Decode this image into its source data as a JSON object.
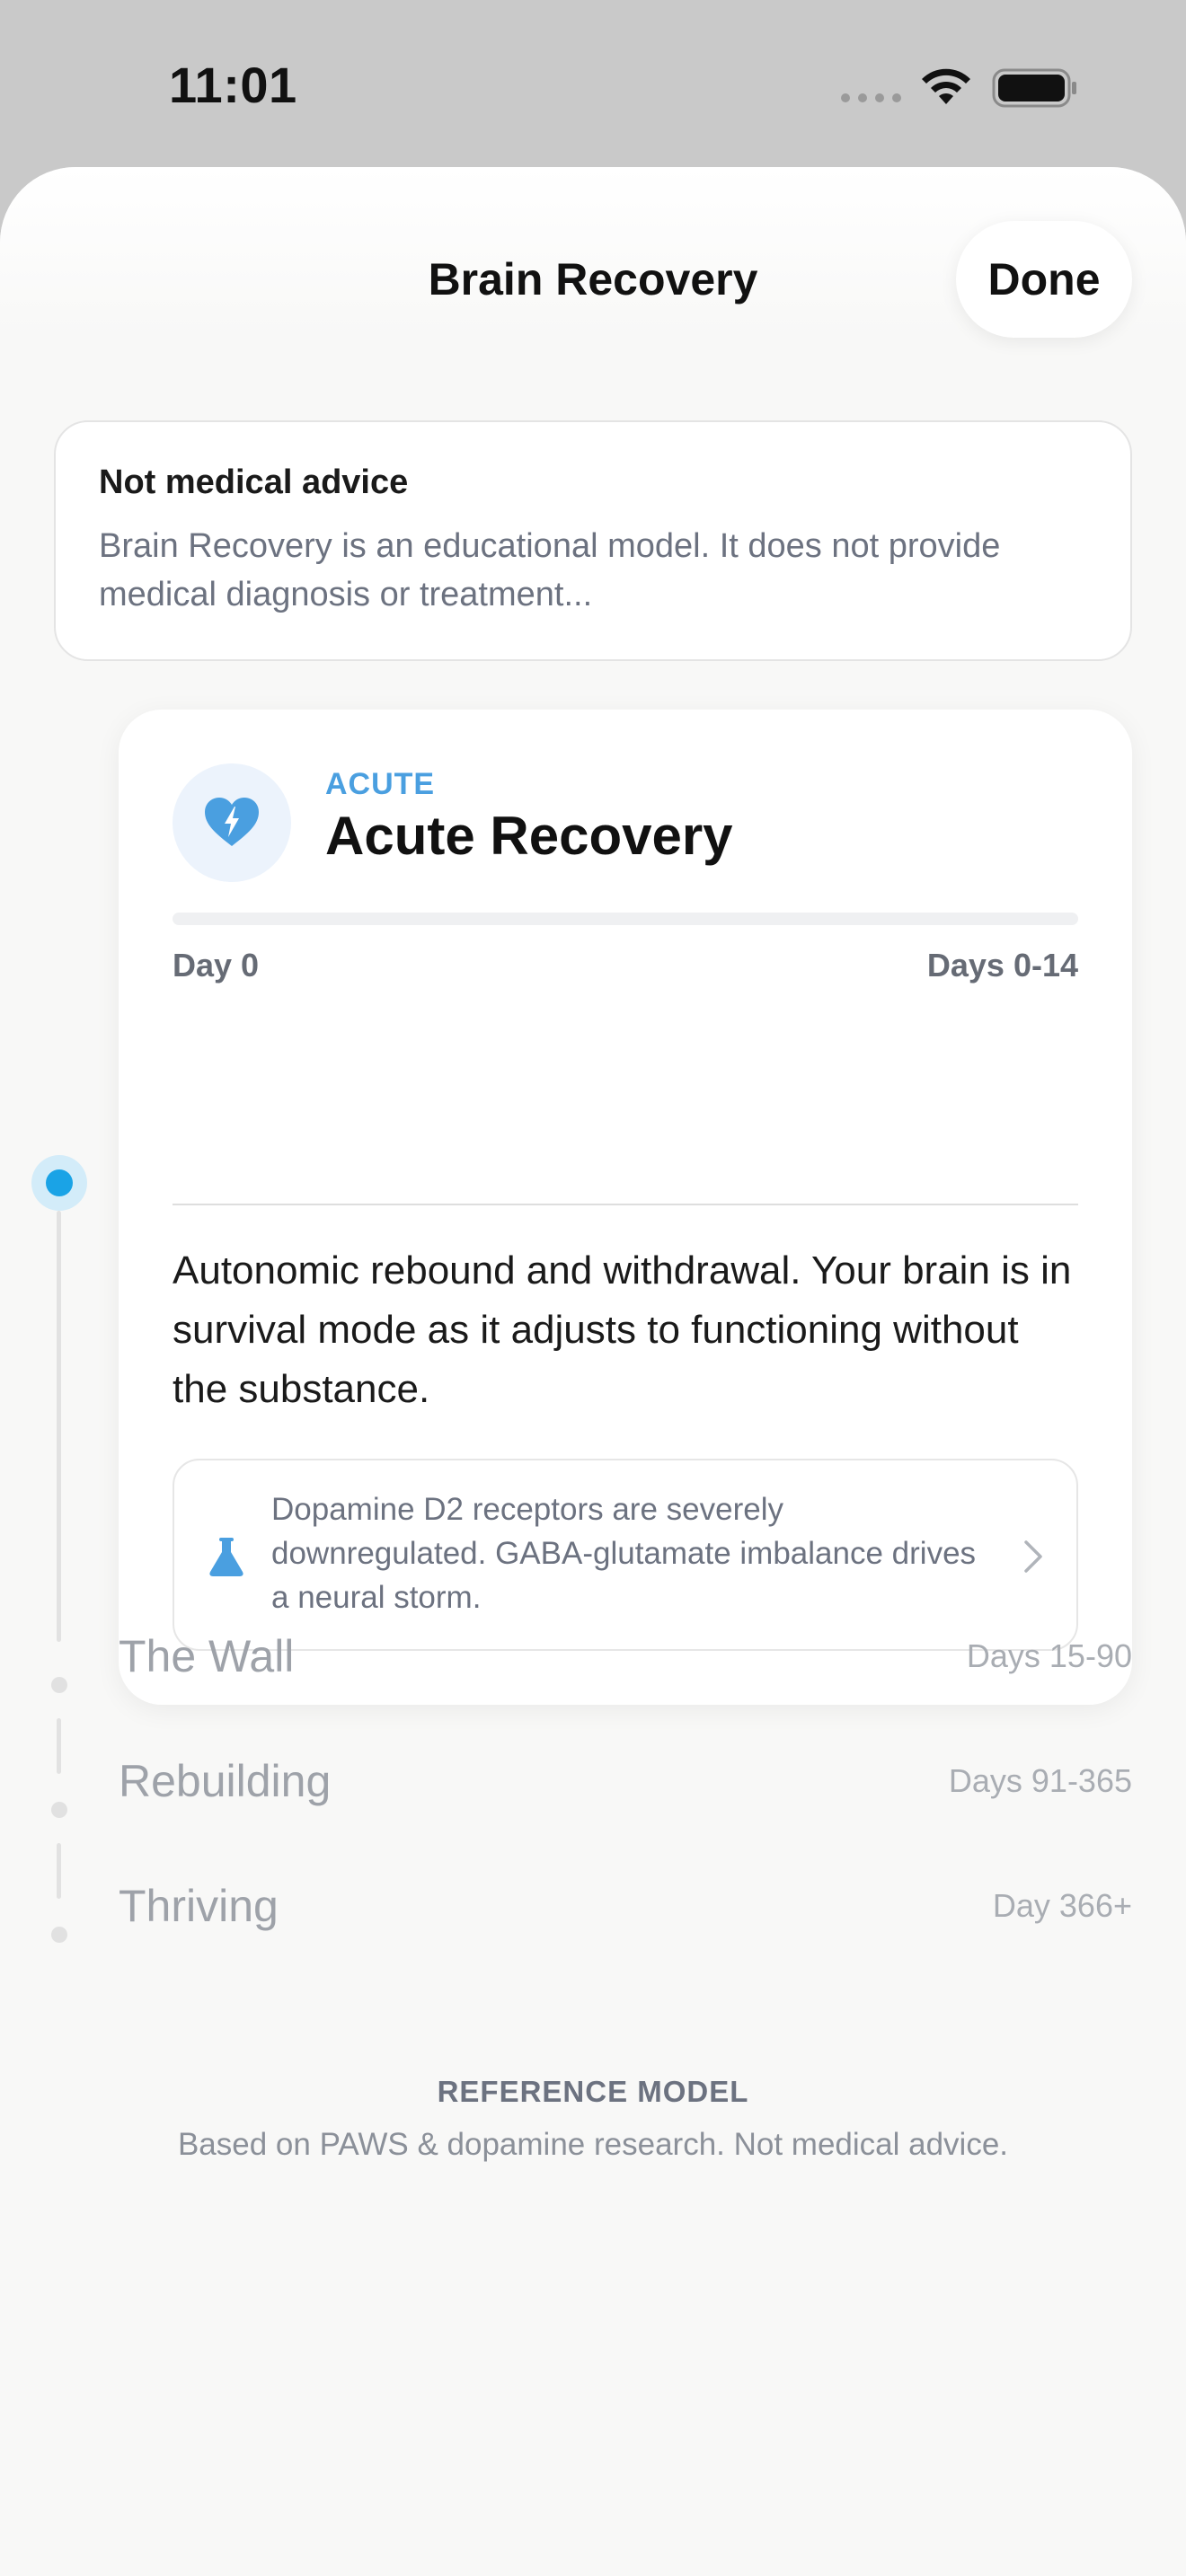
{
  "status_bar": {
    "time": "11:01"
  },
  "sheet": {
    "title": "Brain Recovery",
    "done_label": "Done"
  },
  "disclaimer": {
    "title": "Not medical advice",
    "text": "Brain Recovery is an educational model. It does not provide medical diagnosis or treatment..."
  },
  "current_stage": {
    "kicker": "ACUTE",
    "title": "Acute Recovery",
    "icon": "heart-bolt-icon",
    "progress_start": "Day 0",
    "progress_end": "Days 0-14",
    "progress_fraction": 0.0,
    "description": "Autonomic rebound and withdrawal. Your brain is in survival mode as it adjusts to functioning without the substance.",
    "science_note": "Dopamine D2 receptors are severely downregulated. GABA-glutamate imbalance drives a neural storm.",
    "science_icon": "flask-icon",
    "accent_color": "#4a9fe0"
  },
  "upcoming_stages": [
    {
      "name": "The Wall",
      "range": "Days 15-90"
    },
    {
      "name": "Rebuilding",
      "range": "Days 91-365"
    },
    {
      "name": "Thriving",
      "range": "Day 366+"
    }
  ],
  "footer": {
    "title": "REFERENCE MODEL",
    "text": "Based on PAWS & dopamine research. Not medical advice."
  },
  "colors": {
    "timeline_active": "#1aa3e6",
    "accent": "#4a9fe0"
  }
}
